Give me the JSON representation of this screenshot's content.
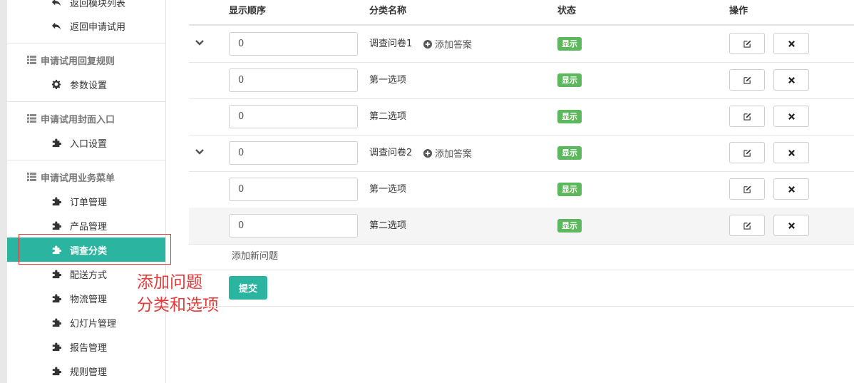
{
  "sidebar": {
    "back_items": [
      {
        "label": "返回模块列表",
        "icon": "reply-icon"
      },
      {
        "label": "返回申请试用",
        "icon": "reply-icon"
      }
    ],
    "groups": [
      {
        "title": "申请试用回复规则",
        "icon": "list-icon",
        "items": [
          {
            "label": "参数设置",
            "icon": "gear-icon"
          }
        ]
      },
      {
        "title": "申请试用封面入口",
        "icon": "list-icon",
        "items": [
          {
            "label": "入口设置",
            "icon": "puzzle-icon"
          }
        ]
      },
      {
        "title": "申请试用业务菜单",
        "icon": "list-icon",
        "items": [
          {
            "label": "订单管理",
            "icon": "puzzle-icon"
          },
          {
            "label": "产品管理",
            "icon": "puzzle-icon"
          },
          {
            "label": "调查分类",
            "icon": "puzzle-icon",
            "active": true
          },
          {
            "label": "配送方式",
            "icon": "puzzle-icon"
          },
          {
            "label": "物流管理",
            "icon": "puzzle-icon"
          },
          {
            "label": "幻灯片管理",
            "icon": "puzzle-icon"
          },
          {
            "label": "报告管理",
            "icon": "puzzle-icon"
          },
          {
            "label": "规则管理",
            "icon": "puzzle-icon"
          }
        ]
      }
    ]
  },
  "annotation": {
    "line1": "添加问题",
    "line2": "分类和选项",
    "color": "#e23b3b"
  },
  "table": {
    "headers": {
      "order": "显示顺序",
      "name": "分类名称",
      "status": "状态",
      "actions": "操作"
    },
    "rows": [
      {
        "order": "0",
        "name": "调查问卷1",
        "add_answer": "添加答案",
        "status": "显示",
        "expandable": true
      },
      {
        "order": "0",
        "name": "第一选项",
        "status": "显示"
      },
      {
        "order": "0",
        "name": "第二选项",
        "status": "显示"
      },
      {
        "order": "0",
        "name": "调查问卷2",
        "add_answer": "添加答案",
        "status": "显示",
        "expandable": true
      },
      {
        "order": "0",
        "name": "第一选项",
        "status": "显示"
      },
      {
        "order": "0",
        "name": "第二选项",
        "status": "显示",
        "highlighted": true
      }
    ],
    "add_question": "添加新问题",
    "submit": "提交"
  },
  "colors": {
    "accent": "#2bb4a0",
    "status_show": "#5cb85c"
  }
}
